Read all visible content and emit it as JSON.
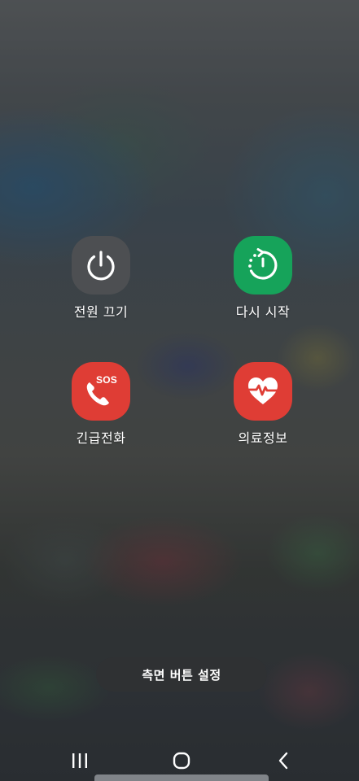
{
  "power_menu": {
    "actions": [
      {
        "id": "power-off",
        "label": "전원 끄기",
        "icon": "power-icon",
        "color": "#4d4f52"
      },
      {
        "id": "restart",
        "label": "다시 시작",
        "icon": "restart-icon",
        "color": "#16a35a"
      },
      {
        "id": "emergency-call",
        "label": "긴급전화",
        "icon": "emergency-call-icon",
        "badge": "SOS",
        "color": "#df3d35"
      },
      {
        "id": "medical-info",
        "label": "의료정보",
        "icon": "medical-heart-icon",
        "color": "#df3d35"
      }
    ],
    "side_key_settings_label": "측면 버튼 설정"
  },
  "navigation_bar": {
    "buttons": [
      {
        "id": "recents",
        "icon": "recents-icon"
      },
      {
        "id": "home",
        "icon": "home-icon"
      },
      {
        "id": "back",
        "icon": "back-icon"
      }
    ]
  }
}
